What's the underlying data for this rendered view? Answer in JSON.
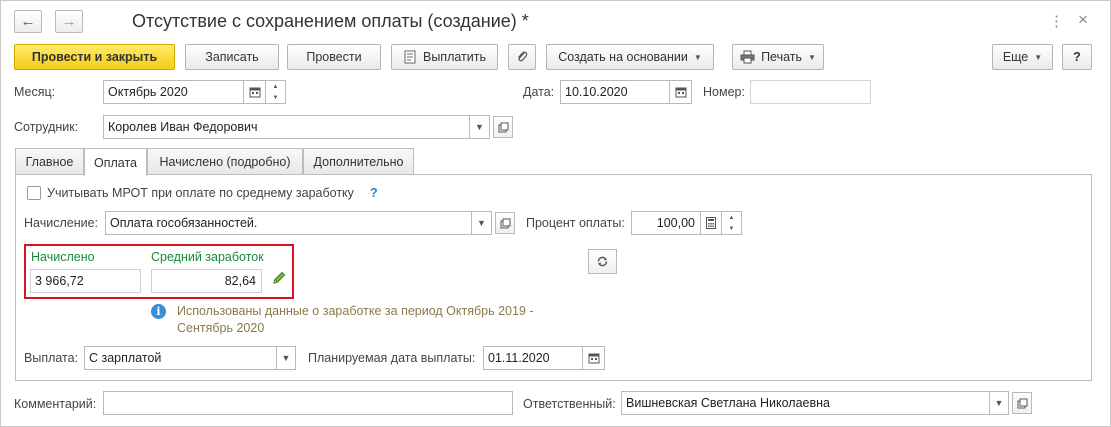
{
  "window": {
    "title": "Отсутствие с сохранением оплаты (создание) *",
    "back_icon": "←",
    "forward_icon": "→",
    "menu_icon": "⋮",
    "close_icon": "×"
  },
  "toolbar": {
    "post_close": "Провести и закрыть",
    "save": "Записать",
    "post": "Провести",
    "pay": "Выплатить",
    "create_based": "Создать на основании",
    "print": "Печать",
    "more": "Еще",
    "help": "?"
  },
  "header": {
    "month_label": "Месяц:",
    "month_value": "Октябрь 2020",
    "date_label": "Дата:",
    "date_value": "10.10.2020",
    "number_label": "Номер:",
    "number_value": "",
    "employee_label": "Сотрудник:",
    "employee_value": "Королев Иван Федорович"
  },
  "tabs": [
    {
      "label": "Главное"
    },
    {
      "label": "Оплата"
    },
    {
      "label": "Начислено (подробно)"
    },
    {
      "label": "Дополнительно"
    }
  ],
  "payment": {
    "mrot_label": "Учитывать МРОТ при оплате по среднему заработку",
    "mrot_help": "?",
    "accrual_label": "Начисление:",
    "accrual_value": "Оплата гособязанностей.",
    "percent_label": "Процент оплаты:",
    "percent_value": "100,00",
    "accrued_label": "Начислено",
    "accrued_value": "3 966,72",
    "avg_label": "Средний заработок",
    "avg_value": "82,64",
    "info_text": "Использованы данные о заработке за период Октябрь 2019 - Сентябрь 2020",
    "payout_label": "Выплата:",
    "payout_value": "С зарплатой",
    "planned_date_label": "Планируемая дата выплаты:",
    "planned_date_value": "01.11.2020"
  },
  "footer": {
    "comment_label": "Комментарий:",
    "comment_value": "",
    "responsible_label": "Ответственный:",
    "responsible_value": "Вишневская Светлана Николаевна"
  },
  "colors": {
    "primary_button": "#f5cd16",
    "highlight_border": "#d4141f",
    "green_labels": "#1b8a3a",
    "info_text": "#8a7a4a",
    "info_icon": "#3b8ed6"
  },
  "icons": {
    "pay_icon": "document-icon",
    "attach_icon": "paperclip-icon",
    "print_icon": "printer-icon",
    "calendar_icon": "calendar-icon",
    "open_icon": "open-form-icon",
    "refresh_icon": "refresh-icon",
    "edit_icon": "pencil-icon",
    "info_icon": "info-icon"
  }
}
